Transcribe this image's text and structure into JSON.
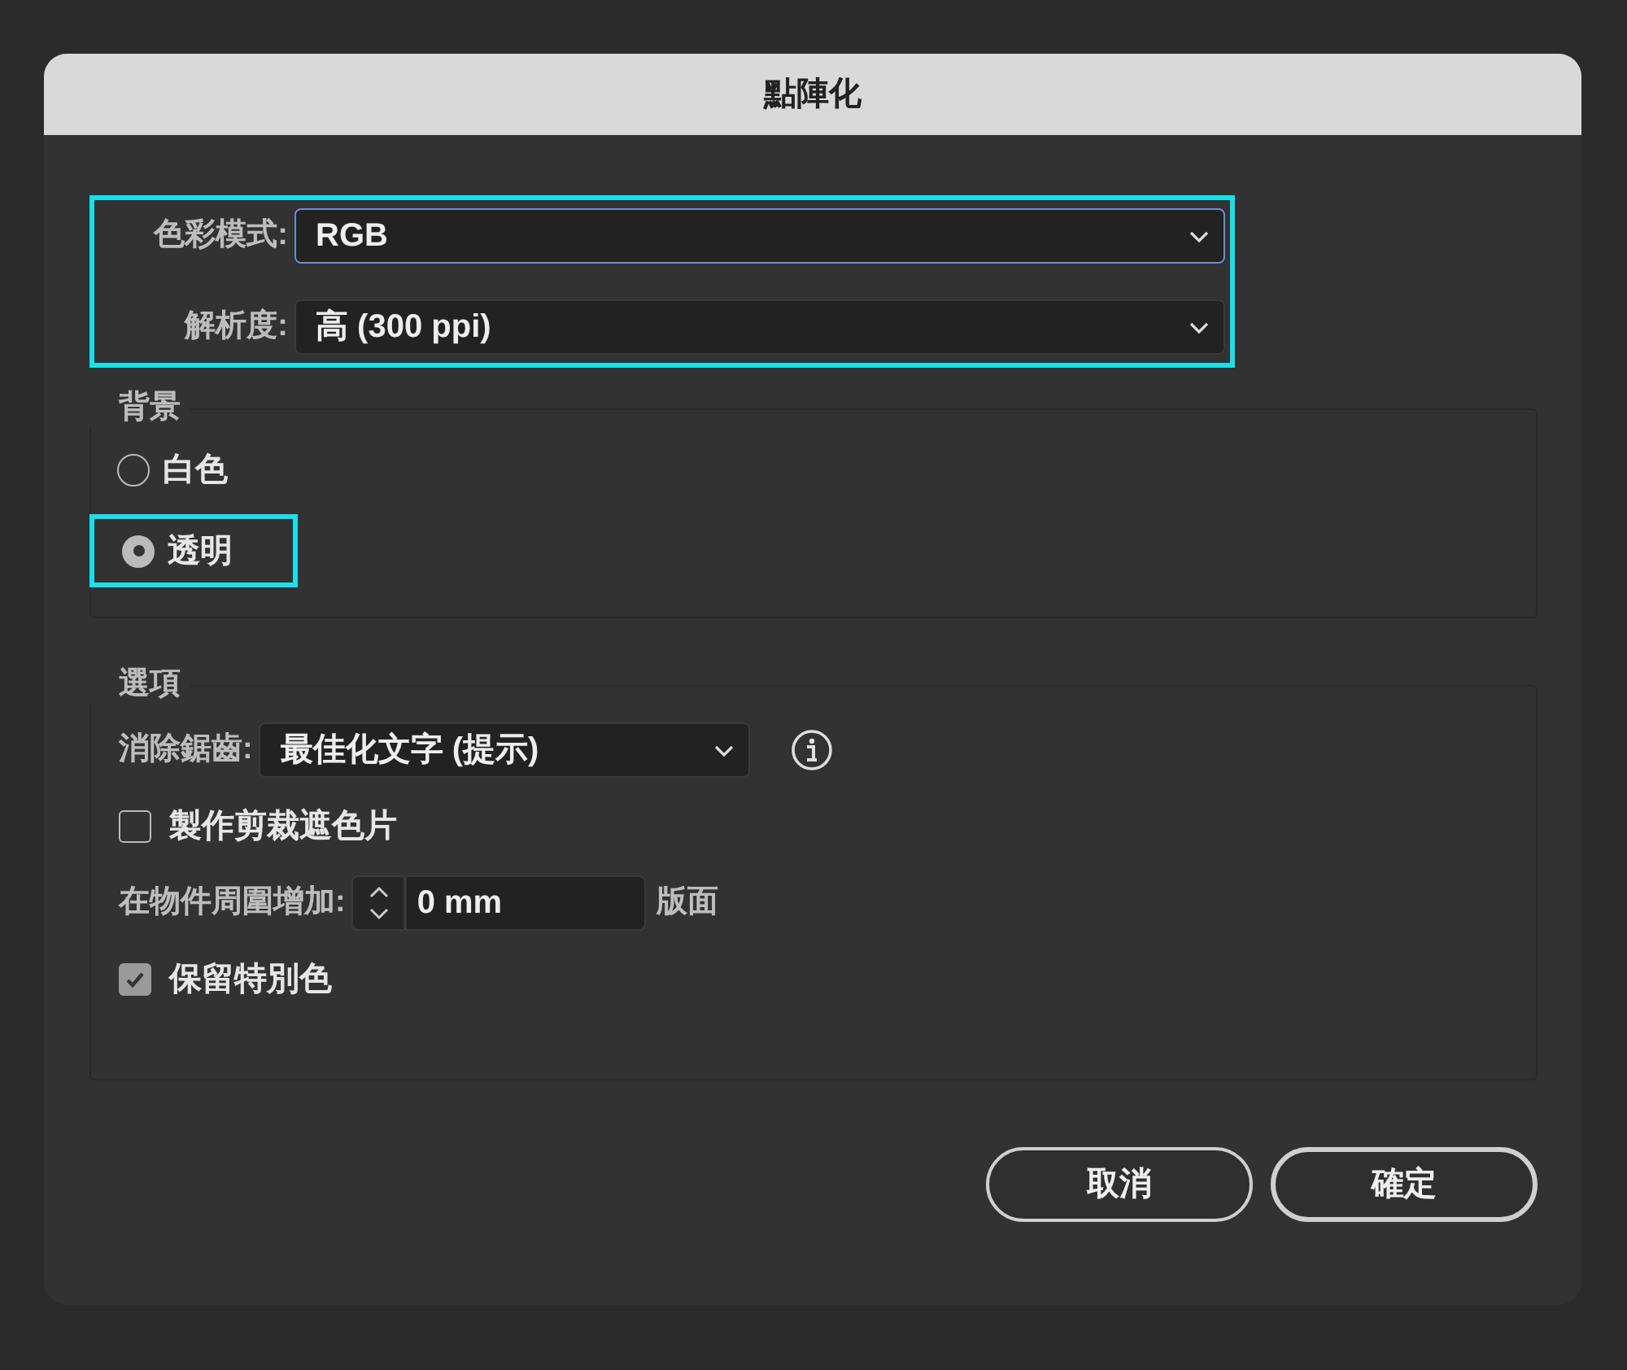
{
  "dialog": {
    "title": "點陣化"
  },
  "format_group": {
    "highlighted": true,
    "rows": [
      {
        "label": "色彩模式:",
        "value": "RGB",
        "focused": true
      },
      {
        "label": "解析度:",
        "value": "高 (300 ppi)",
        "focused": false
      }
    ]
  },
  "background": {
    "legend": "背景",
    "options": [
      {
        "label": "白色",
        "selected": false,
        "highlighted": false
      },
      {
        "label": "透明",
        "selected": true,
        "highlighted": true
      }
    ]
  },
  "options": {
    "legend": "選項",
    "anti_alias": {
      "label": "消除鋸齒:",
      "value": "最佳化文字 (提示)"
    },
    "items": [
      {
        "kind": "checkbox",
        "label": "製作剪裁遮色片",
        "checked": false
      },
      {
        "kind": "spinner",
        "label": "在物件周圍增加:",
        "value": "0 mm",
        "unit": "版面"
      },
      {
        "kind": "checkbox",
        "label": "保留特別色",
        "checked": true
      }
    ]
  },
  "buttons": [
    {
      "label": "取消",
      "default": false
    },
    {
      "label": "確定",
      "default": true
    }
  ]
}
